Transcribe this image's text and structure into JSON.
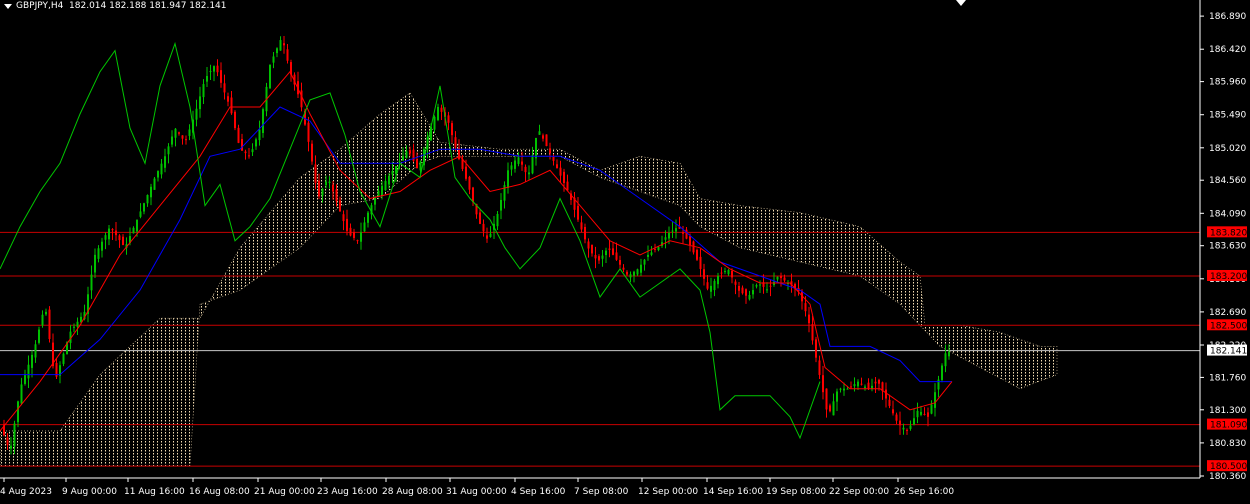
{
  "header": {
    "symbol_timeframe": "GBPJPY,H4",
    "ohlc": "182.014 182.188 181.947 182.141"
  },
  "colors": {
    "bg": "#000000",
    "grid": "#1a1a1a",
    "axis": "#ffffff",
    "bull": "#00c000",
    "bear": "#ff0000",
    "kijun": "#0000ff",
    "tenkan": "#ff0000",
    "chikou": "#00c800",
    "cloud": "#f5deb3",
    "level": "#c80000",
    "price_label_bg": "#ff0000",
    "current_bg": "#ffffff"
  },
  "chart_data": {
    "type": "candlestick",
    "instrument": "GBPJPY",
    "timeframe": "H4",
    "y_range": [
      180.36,
      186.92
    ],
    "y_ticks": [
      "186.890",
      "186.420",
      "185.960",
      "185.490",
      "185.020",
      "184.560",
      "184.090",
      "183.630",
      "183.160",
      "182.690",
      "182.220",
      "181.760",
      "181.300",
      "180.830",
      "180.360"
    ],
    "x_ticks": [
      "4 Aug 2023",
      "9 Aug 00:00",
      "11 Aug 16:00",
      "16 Aug 08:00",
      "21 Aug 00:00",
      "23 Aug 16:00",
      "28 Aug 08:00",
      "31 Aug 00:00",
      "4 Sep 16:00",
      "7 Sep 08:00",
      "12 Sep 00:00",
      "14 Sep 16:00",
      "19 Sep 08:00",
      "22 Sep 00:00",
      "26 Sep 16:00"
    ],
    "horizontal_levels": [
      {
        "price": 183.82,
        "label": "183.820"
      },
      {
        "price": 183.2,
        "label": "183.200"
      },
      {
        "price": 182.5,
        "label": "182.500"
      },
      {
        "price": 181.09,
        "label": "181.090"
      },
      {
        "price": 180.5,
        "label": "180.500"
      }
    ],
    "current_price": {
      "price": 182.141,
      "label": "182.141"
    },
    "price_path": [
      [
        0,
        181.1
      ],
      [
        10,
        180.7
      ],
      [
        20,
        181.6
      ],
      [
        35,
        182.2
      ],
      [
        45,
        182.8
      ],
      [
        55,
        181.7
      ],
      [
        70,
        182.4
      ],
      [
        85,
        182.7
      ],
      [
        95,
        183.5
      ],
      [
        110,
        183.9
      ],
      [
        125,
        183.6
      ],
      [
        140,
        184.1
      ],
      [
        155,
        184.6
      ],
      [
        165,
        184.9
      ],
      [
        175,
        185.3
      ],
      [
        185,
        185.1
      ],
      [
        195,
        185.5
      ],
      [
        205,
        186.0
      ],
      [
        215,
        186.2
      ],
      [
        222,
        185.9
      ],
      [
        230,
        185.6
      ],
      [
        240,
        185.0
      ],
      [
        250,
        184.9
      ],
      [
        260,
        185.3
      ],
      [
        270,
        186.2
      ],
      [
        282,
        186.6
      ],
      [
        290,
        186.1
      ],
      [
        300,
        185.7
      ],
      [
        310,
        185.0
      ],
      [
        318,
        184.3
      ],
      [
        328,
        184.6
      ],
      [
        338,
        184.2
      ],
      [
        348,
        183.8
      ],
      [
        358,
        183.7
      ],
      [
        368,
        184.1
      ],
      [
        378,
        184.4
      ],
      [
        388,
        184.6
      ],
      [
        398,
        184.8
      ],
      [
        408,
        185.0
      ],
      [
        418,
        184.7
      ],
      [
        428,
        185.2
      ],
      [
        438,
        185.6
      ],
      [
        448,
        185.4
      ],
      [
        458,
        184.9
      ],
      [
        468,
        184.5
      ],
      [
        478,
        184.0
      ],
      [
        488,
        183.7
      ],
      [
        498,
        184.1
      ],
      [
        508,
        184.7
      ],
      [
        518,
        184.9
      ],
      [
        528,
        184.6
      ],
      [
        538,
        185.3
      ],
      [
        548,
        185.0
      ],
      [
        558,
        184.7
      ],
      [
        568,
        184.4
      ],
      [
        578,
        184.0
      ],
      [
        588,
        183.6
      ],
      [
        598,
        183.4
      ],
      [
        608,
        183.6
      ],
      [
        618,
        183.4
      ],
      [
        628,
        183.2
      ],
      [
        638,
        183.3
      ],
      [
        648,
        183.5
      ],
      [
        658,
        183.6
      ],
      [
        668,
        183.8
      ],
      [
        678,
        183.9
      ],
      [
        688,
        183.7
      ],
      [
        698,
        183.4
      ],
      [
        708,
        183.0
      ],
      [
        718,
        183.2
      ],
      [
        728,
        183.3
      ],
      [
        738,
        183.0
      ],
      [
        748,
        182.9
      ],
      [
        758,
        183.1
      ],
      [
        768,
        183.0
      ],
      [
        778,
        183.2
      ],
      [
        788,
        183.1
      ],
      [
        798,
        183.0
      ],
      [
        808,
        182.6
      ],
      [
        818,
        181.9
      ],
      [
        828,
        181.2
      ],
      [
        838,
        181.6
      ],
      [
        848,
        181.6
      ],
      [
        858,
        181.7
      ],
      [
        868,
        181.6
      ],
      [
        878,
        181.7
      ],
      [
        888,
        181.4
      ],
      [
        898,
        181.1
      ],
      [
        908,
        181.0
      ],
      [
        918,
        181.3
      ],
      [
        928,
        181.2
      ],
      [
        938,
        181.7
      ],
      [
        945,
        182.1
      ],
      [
        952,
        182.14
      ]
    ],
    "tenkan_path": [
      [
        0,
        181.0
      ],
      [
        40,
        181.7
      ],
      [
        80,
        182.5
      ],
      [
        120,
        183.5
      ],
      [
        160,
        184.2
      ],
      [
        200,
        184.9
      ],
      [
        230,
        185.6
      ],
      [
        260,
        185.6
      ],
      [
        290,
        186.1
      ],
      [
        310,
        185.5
      ],
      [
        340,
        184.7
      ],
      [
        370,
        184.3
      ],
      [
        400,
        184.4
      ],
      [
        430,
        184.7
      ],
      [
        460,
        184.9
      ],
      [
        490,
        184.4
      ],
      [
        520,
        184.5
      ],
      [
        550,
        184.7
      ],
      [
        580,
        184.2
      ],
      [
        610,
        183.7
      ],
      [
        640,
        183.5
      ],
      [
        670,
        183.7
      ],
      [
        700,
        183.6
      ],
      [
        730,
        183.3
      ],
      [
        760,
        183.1
      ],
      [
        790,
        183.1
      ],
      [
        810,
        182.8
      ],
      [
        825,
        181.9
      ],
      [
        850,
        181.6
      ],
      [
        880,
        181.6
      ],
      [
        910,
        181.3
      ],
      [
        935,
        181.4
      ],
      [
        952,
        181.7
      ]
    ],
    "kijun_path": [
      [
        0,
        181.8
      ],
      [
        60,
        181.8
      ],
      [
        100,
        182.3
      ],
      [
        140,
        183.0
      ],
      [
        180,
        184.0
      ],
      [
        210,
        184.9
      ],
      [
        240,
        185.0
      ],
      [
        280,
        185.6
      ],
      [
        310,
        185.4
      ],
      [
        340,
        184.8
      ],
      [
        400,
        184.8
      ],
      [
        440,
        185.0
      ],
      [
        480,
        185.0
      ],
      [
        520,
        184.9
      ],
      [
        560,
        184.9
      ],
      [
        600,
        184.7
      ],
      [
        640,
        184.3
      ],
      [
        680,
        183.9
      ],
      [
        720,
        183.4
      ],
      [
        760,
        183.2
      ],
      [
        800,
        183.0
      ],
      [
        820,
        182.8
      ],
      [
        830,
        182.2
      ],
      [
        870,
        182.2
      ],
      [
        900,
        182.0
      ],
      [
        920,
        181.7
      ],
      [
        952,
        181.7
      ]
    ],
    "chikou_path": [
      [
        0,
        183.3
      ],
      [
        20,
        183.9
      ],
      [
        40,
        184.4
      ],
      [
        60,
        184.8
      ],
      [
        80,
        185.5
      ],
      [
        100,
        186.1
      ],
      [
        115,
        186.4
      ],
      [
        130,
        185.3
      ],
      [
        145,
        184.8
      ],
      [
        160,
        185.9
      ],
      [
        175,
        186.5
      ],
      [
        190,
        185.6
      ],
      [
        205,
        184.2
      ],
      [
        220,
        184.5
      ],
      [
        235,
        183.7
      ],
      [
        250,
        183.9
      ],
      [
        270,
        184.3
      ],
      [
        290,
        185.0
      ],
      [
        310,
        185.7
      ],
      [
        330,
        185.8
      ],
      [
        345,
        185.2
      ],
      [
        360,
        184.4
      ],
      [
        380,
        183.9
      ],
      [
        400,
        184.8
      ],
      [
        420,
        184.6
      ],
      [
        440,
        185.9
      ],
      [
        455,
        184.6
      ],
      [
        470,
        184.3
      ],
      [
        490,
        184.0
      ],
      [
        505,
        183.6
      ],
      [
        520,
        183.3
      ],
      [
        540,
        183.6
      ],
      [
        560,
        184.3
      ],
      [
        580,
        183.7
      ],
      [
        600,
        182.9
      ],
      [
        620,
        183.3
      ],
      [
        640,
        182.9
      ],
      [
        660,
        183.1
      ],
      [
        680,
        183.3
      ],
      [
        700,
        183.0
      ],
      [
        710,
        182.4
      ],
      [
        720,
        181.3
      ],
      [
        735,
        181.5
      ],
      [
        750,
        181.5
      ],
      [
        770,
        181.5
      ],
      [
        790,
        181.2
      ],
      [
        800,
        180.9
      ],
      [
        820,
        181.7
      ]
    ],
    "cloud": {
      "upper": [
        [
          0,
          181.0
        ],
        [
          60,
          181.0
        ],
        [
          100,
          181.8
        ],
        [
          160,
          182.6
        ],
        [
          200,
          182.6
        ],
        [
          240,
          183.6
        ],
        [
          300,
          184.6
        ],
        [
          340,
          185.0
        ],
        [
          380,
          185.5
        ],
        [
          410,
          185.8
        ],
        [
          440,
          185.1
        ],
        [
          500,
          185.0
        ],
        [
          560,
          185.0
        ],
        [
          600,
          184.7
        ],
        [
          640,
          184.9
        ],
        [
          680,
          184.8
        ],
        [
          700,
          184.3
        ],
        [
          740,
          184.2
        ],
        [
          800,
          184.1
        ],
        [
          860,
          183.9
        ],
        [
          900,
          183.4
        ],
        [
          920,
          183.2
        ],
        [
          925,
          182.5
        ],
        [
          960,
          182.5
        ],
        [
          1000,
          182.4
        ],
        [
          1040,
          182.2
        ],
        [
          1057,
          182.2
        ]
      ],
      "lower": [
        [
          0,
          180.5
        ],
        [
          60,
          180.5
        ],
        [
          100,
          180.5
        ],
        [
          160,
          180.5
        ],
        [
          190,
          180.5
        ],
        [
          200,
          182.8
        ],
        [
          240,
          183.0
        ],
        [
          300,
          183.6
        ],
        [
          340,
          184.2
        ],
        [
          380,
          184.3
        ],
        [
          420,
          184.8
        ],
        [
          440,
          184.9
        ],
        [
          500,
          184.9
        ],
        [
          560,
          184.9
        ],
        [
          600,
          184.6
        ],
        [
          640,
          184.4
        ],
        [
          680,
          184.2
        ],
        [
          700,
          183.9
        ],
        [
          740,
          183.6
        ],
        [
          800,
          183.4
        ],
        [
          860,
          183.2
        ],
        [
          900,
          182.8
        ],
        [
          920,
          182.5
        ],
        [
          940,
          182.2
        ],
        [
          980,
          181.9
        ],
        [
          1020,
          181.6
        ],
        [
          1057,
          181.8
        ]
      ]
    }
  }
}
